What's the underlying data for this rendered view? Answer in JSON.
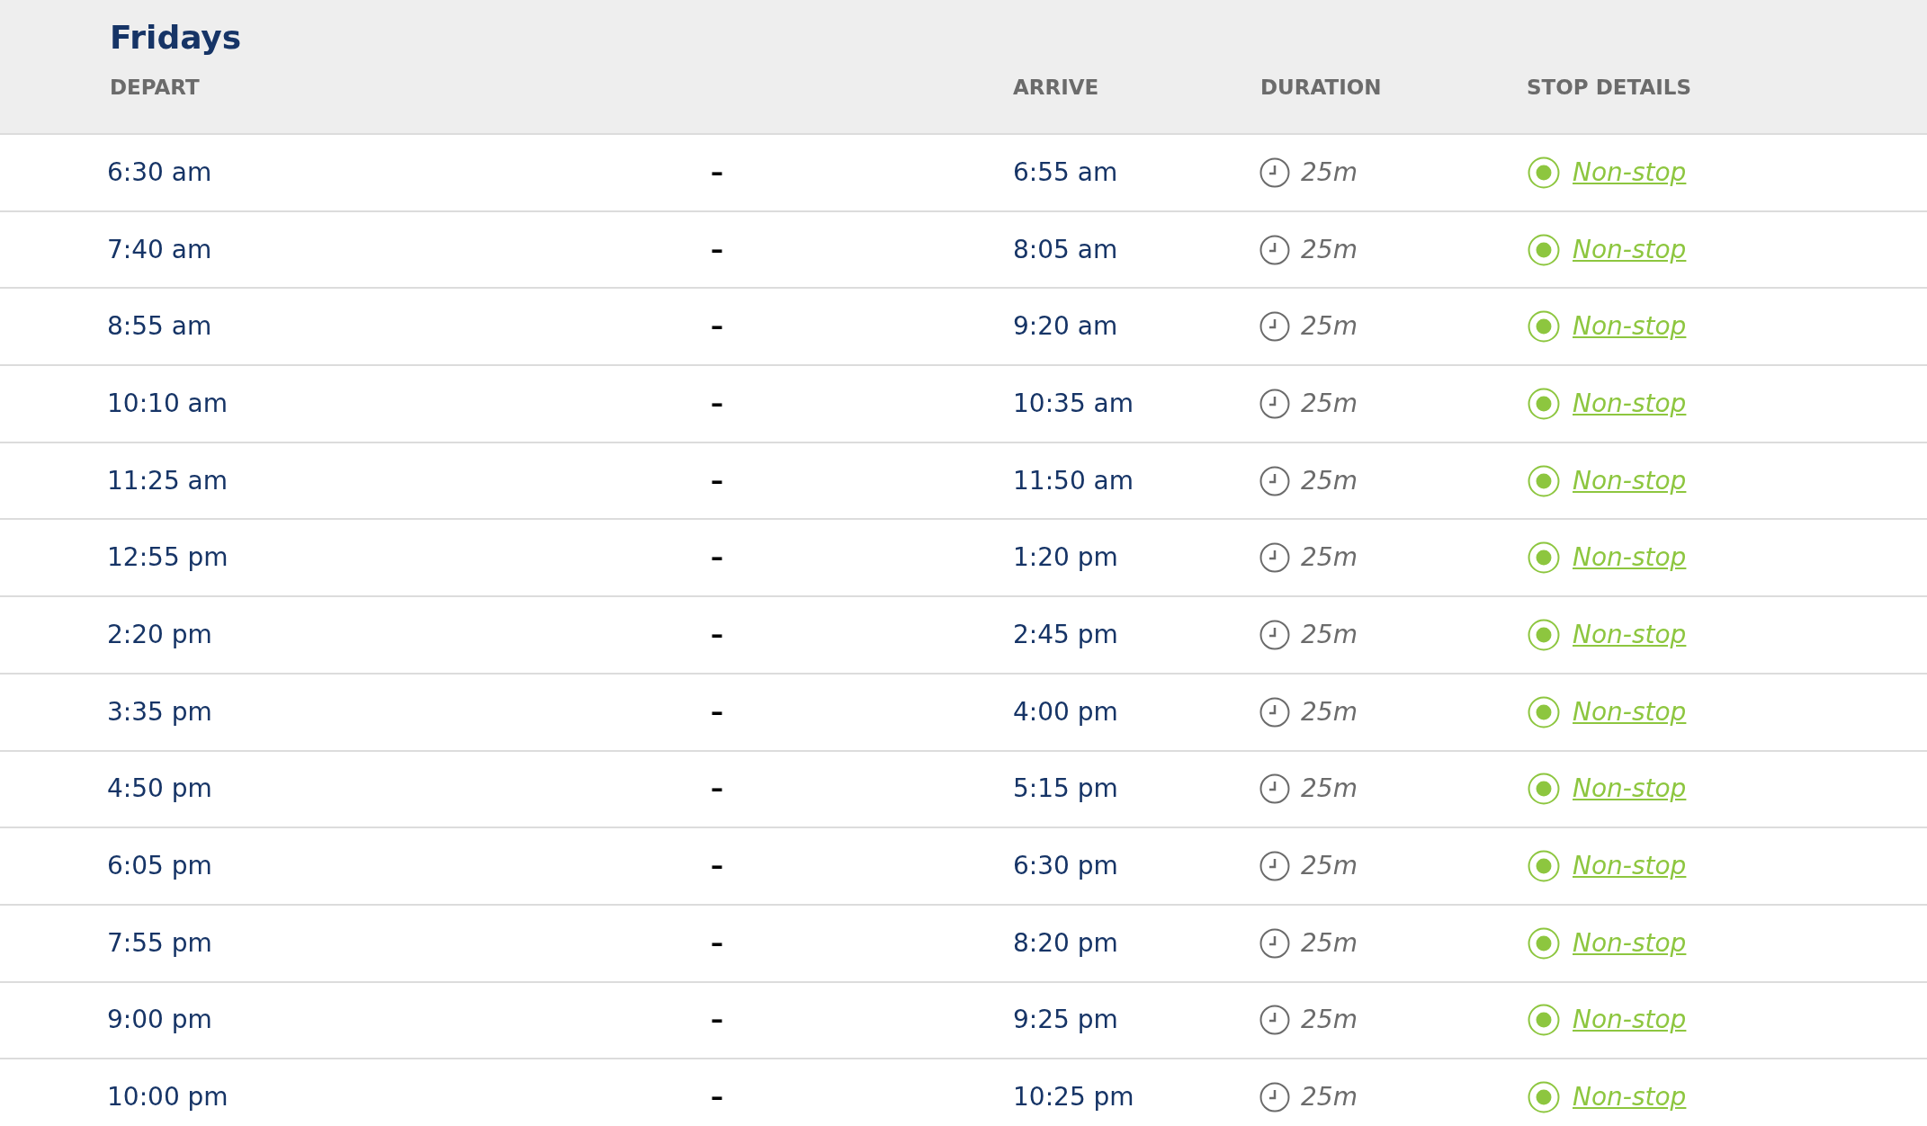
{
  "title": "Fridays",
  "columns": [
    "DEPART",
    "ARRIVE",
    "DURATION",
    "STOP DETAILS"
  ],
  "rows": [
    {
      "depart": "6:30 am",
      "separator": "–",
      "arrive": "6:55 am",
      "duration": "25m",
      "stops": "Non-stop"
    },
    {
      "depart": "7:40 am",
      "separator": "–",
      "arrive": "8:05 am",
      "duration": "25m",
      "stops": "Non-stop"
    },
    {
      "depart": "8:55 am",
      "separator": "–",
      "arrive": "9:20 am",
      "duration": "25m",
      "stops": "Non-stop"
    },
    {
      "depart": "10:10 am",
      "separator": "–",
      "arrive": "10:35 am",
      "duration": "25m",
      "stops": "Non-stop"
    },
    {
      "depart": "11:25 am",
      "separator": "–",
      "arrive": "11:50 am",
      "duration": "25m",
      "stops": "Non-stop"
    },
    {
      "depart": "12:55 pm",
      "separator": "–",
      "arrive": "1:20 pm",
      "duration": "25m",
      "stops": "Non-stop"
    },
    {
      "depart": "2:20 pm",
      "separator": "–",
      "arrive": "2:45 pm",
      "duration": "25m",
      "stops": "Non-stop"
    },
    {
      "depart": "3:35 pm",
      "separator": "–",
      "arrive": "4:00 pm",
      "duration": "25m",
      "stops": "Non-stop"
    },
    {
      "depart": "4:50 pm",
      "separator": "–",
      "arrive": "5:15 pm",
      "duration": "25m",
      "stops": "Non-stop"
    },
    {
      "depart": "6:05 pm",
      "separator": "–",
      "arrive": "6:30 pm",
      "duration": "25m",
      "stops": "Non-stop"
    },
    {
      "depart": "7:55 pm",
      "separator": "–",
      "arrive": "8:20 pm",
      "duration": "25m",
      "stops": "Non-stop"
    },
    {
      "depart": "9:00 pm",
      "separator": "–",
      "arrive": "9:25 pm",
      "duration": "25m",
      "stops": "Non-stop"
    },
    {
      "depart": "10:00 pm",
      "separator": "–",
      "arrive": "10:25 pm",
      "duration": "25m",
      "stops": "Non-stop"
    }
  ]
}
